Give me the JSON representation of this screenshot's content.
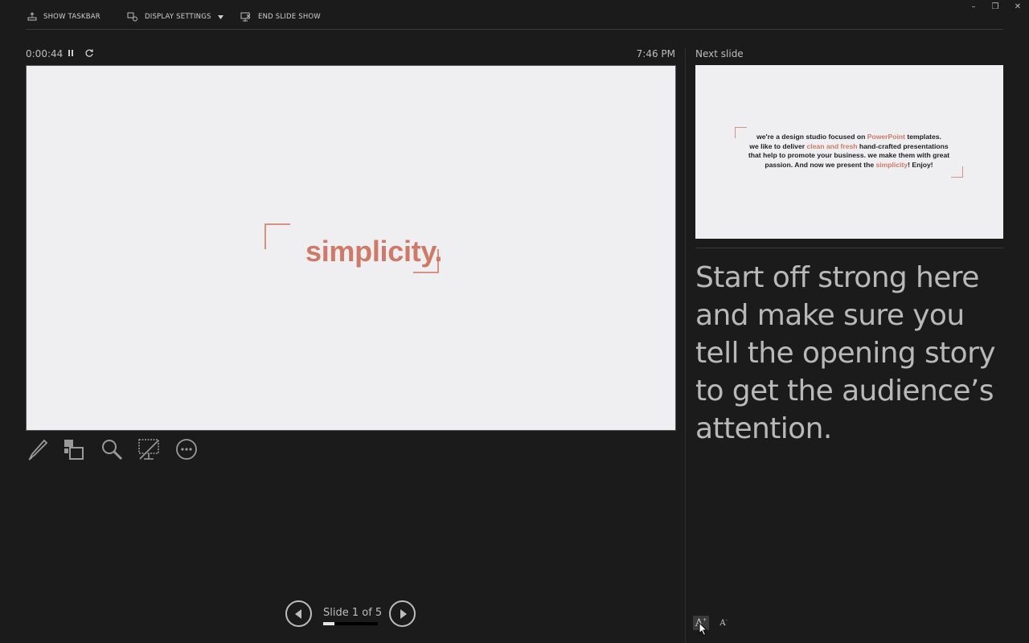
{
  "topbar": {
    "show_taskbar": "SHOW TASKBAR",
    "display_settings": "DISPLAY SETTINGS",
    "end_slide_show": "END SLIDE SHOW",
    "minimize": "–",
    "restore": "❐",
    "close": "✕"
  },
  "status": {
    "timer": "0:00:44",
    "clock": "7:46 PM"
  },
  "current_slide": {
    "word": "simplicity."
  },
  "next_slide": {
    "label": "Next slide",
    "lines": [
      [
        "we're a design studio focused on ",
        "PowerPoint",
        " templates."
      ],
      [
        "we like to deliver ",
        "clean and fresh",
        " hand-crafted presentations"
      ],
      [
        "that help to promote your business. we make them with great"
      ],
      [
        "passion. And now we present the ",
        "simplicity",
        "! Enjoy!"
      ]
    ],
    "accent_color": "#cd7a68"
  },
  "notes": {
    "text": "Start off strong here and make sure you tell the opening story to get the audience’s attention."
  },
  "navigation": {
    "slide_count": "Slide 1 of 5",
    "current": 1,
    "total": 5,
    "progress": 0.2
  },
  "tools": [
    "pen-icon",
    "see-all-slides-icon",
    "zoom-icon",
    "black-screen-icon",
    "more-options-icon"
  ],
  "font_controls": {
    "increase": "A",
    "decrease": "A"
  }
}
